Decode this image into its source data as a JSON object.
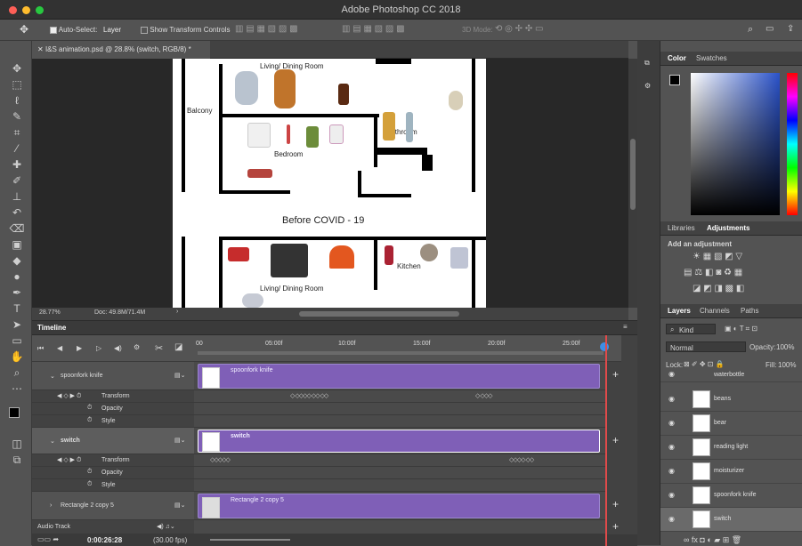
{
  "window": {
    "title": "Adobe Photoshop CC 2018"
  },
  "options_bar": {
    "auto_select_label": "Auto-Select:",
    "auto_select_value": "Layer",
    "show_transform_label": "Show Transform Controls",
    "mode_label": "3D Mode:"
  },
  "document": {
    "tab_label": "I&S animation.psd @ 28.8% (switch, RGB/8) *",
    "rooms": {
      "living_top": "Living/ Dining Room",
      "balcony": "Balcony",
      "bedroom": "Bedroom",
      "bathroom": "Bathroom",
      "caption": "Before COVID - 19",
      "kitchen": "Kitchen",
      "living_bottom": "Living/ Dining Room"
    },
    "zoom": "28.77%",
    "doc_size": "Doc: 49.8M/71.4M"
  },
  "timeline": {
    "panel_title": "Timeline",
    "ruler_ticks": [
      "00",
      "05:00f",
      "10:00f",
      "15:00f",
      "20:00f",
      "25:00f"
    ],
    "tracks": [
      {
        "name": "spoonfork knife",
        "clip_label": "spoonfork knife",
        "props": [
          "Transform",
          "Opacity",
          "Style"
        ]
      },
      {
        "name": "switch",
        "clip_label": "switch",
        "props": [
          "Transform",
          "Opacity",
          "Style"
        ]
      },
      {
        "name": "Rectangle 2 copy 5",
        "clip_label": "Rectangle 2 copy 5",
        "props": []
      }
    ],
    "audio_track": "Audio Track",
    "timecode": "0:00:26:28",
    "fps": "(30.00 fps)",
    "add_glyph": "+"
  },
  "panels": {
    "color_tabs": [
      "Color",
      "Swatches"
    ],
    "adjust_tabs": [
      "Libraries",
      "Adjustments"
    ],
    "adjust_hint": "Add an adjustment",
    "layer_tabs": [
      "Layers",
      "Channels",
      "Paths"
    ],
    "kind_value": "Kind",
    "blend_value": "Normal",
    "opacity_label": "Opacity:",
    "opacity_value": "100%",
    "lock_label": "Lock:",
    "fill_label": "Fill:",
    "fill_value": "100%",
    "layers": [
      "waterbottle",
      "beans",
      "bear",
      "reading light",
      "moisturizer",
      "spoonfork knife",
      "switch"
    ]
  },
  "colors": {
    "accent_clip": "#7f5fb7",
    "playhead": "#e04a4a"
  }
}
